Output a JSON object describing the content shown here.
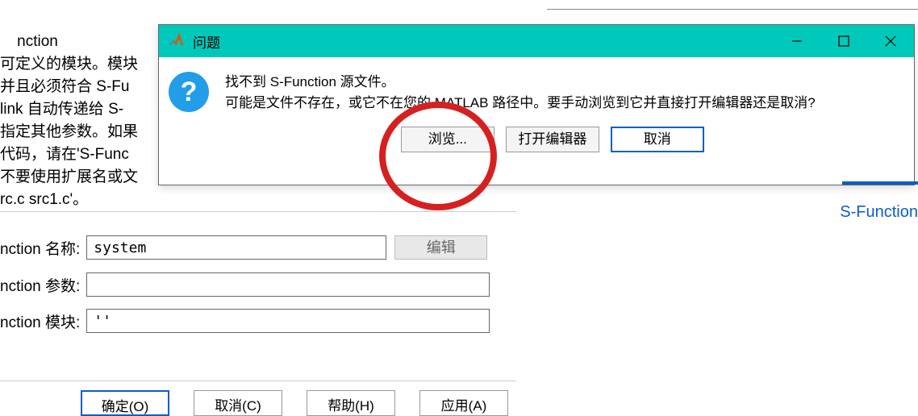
{
  "background": {
    "description_lines": [
      "nction",
      "可定义的模块。模块",
      "并且必须符合 S-Fu",
      "link 自动传递给 S-",
      "指定其他参数。如果",
      "代码，请在'S-Func",
      "不要使用扩展名或文",
      "rc.c src1.c'。"
    ],
    "field_name_label": "nction 名称:",
    "field_name_value": "system",
    "edit_button": "编辑",
    "field_param_label": "nction 参数:",
    "field_param_value": "",
    "field_module_label": "nction 模块:",
    "field_module_value": "''",
    "btn_ok": "确定(O)",
    "btn_cancel": "取消(C)",
    "btn_help": "帮助(H)",
    "btn_apply": "应用(A)"
  },
  "dialog": {
    "title": "问题",
    "message_line1": "找不到 S-Function 源文件。",
    "message_line2": "可能是文件不存在，或它不在您的 MATLAB 路径中。要手动浏览到它并直接打开编辑器还是取消?",
    "btn_browse": "浏览...",
    "btn_open_editor": "打开编辑器",
    "btn_cancel": "取消"
  },
  "right_label": "S-Function"
}
